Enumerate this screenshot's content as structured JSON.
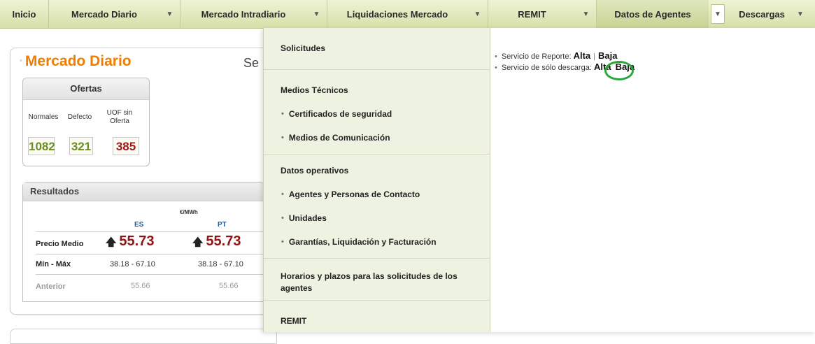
{
  "nav": {
    "items": [
      {
        "label": "Inicio"
      },
      {
        "label": "Mercado Diario"
      },
      {
        "label": "Mercado Intradiario"
      },
      {
        "label": "Liquidaciones Mercado"
      },
      {
        "label": "REMIT"
      },
      {
        "label": "Datos de Agentes"
      },
      {
        "label": "Descargas"
      }
    ],
    "arrow_glyph": "▼",
    "active": "Datos de Agentes"
  },
  "page": {
    "title": "Mercado Diario",
    "title_bullet": "◦",
    "title_color": "#ef7d00",
    "cut_text": "Se",
    "ofertas": {
      "title": "Ofertas",
      "labels": [
        "Normales",
        "Defecto",
        "UOF sin Oferta"
      ],
      "values": [
        "1082",
        "321",
        "385"
      ],
      "value_colors": [
        "#6b8e23",
        "#6b8e23",
        "#a01818"
      ]
    },
    "resultados": {
      "title": "Resultados",
      "unit": "€/MWh",
      "columns": [
        "ES",
        "PT"
      ],
      "rows": [
        {
          "label": "Precio Medio",
          "es": "55.73",
          "pt": "55.73",
          "arrow": "🡅"
        },
        {
          "label": "Mín - Máx",
          "es": "38.18 - 67.10",
          "pt": "38.18 - 67.10"
        },
        {
          "label": "Anterior",
          "es": "55.66",
          "pt": "55.66"
        }
      ]
    }
  },
  "dropdown": {
    "items": [
      {
        "label": "Solicitudes"
      },
      {
        "label": "Medios Técnicos"
      },
      {
        "label": "Certificados de seguridad"
      },
      {
        "label": "Medios de Comunicación"
      },
      {
        "label": "Datos operativos"
      },
      {
        "label": "Agentes y Personas de Contacto"
      },
      {
        "label": "Unidades"
      },
      {
        "label": "Garantías, Liquidación y Facturación"
      },
      {
        "label": "Horarios y plazos para las solicitudes de los agentes"
      },
      {
        "label": "REMIT"
      }
    ],
    "services": [
      {
        "label": "Servicio de Reporte:",
        "alta": "Alta",
        "separator": "|",
        "baja": "Baja"
      },
      {
        "label": "Servicio de sólo descarga:",
        "alta": "Alta",
        "baja": "Baja"
      }
    ],
    "highlight_color": "#2aa83a"
  }
}
